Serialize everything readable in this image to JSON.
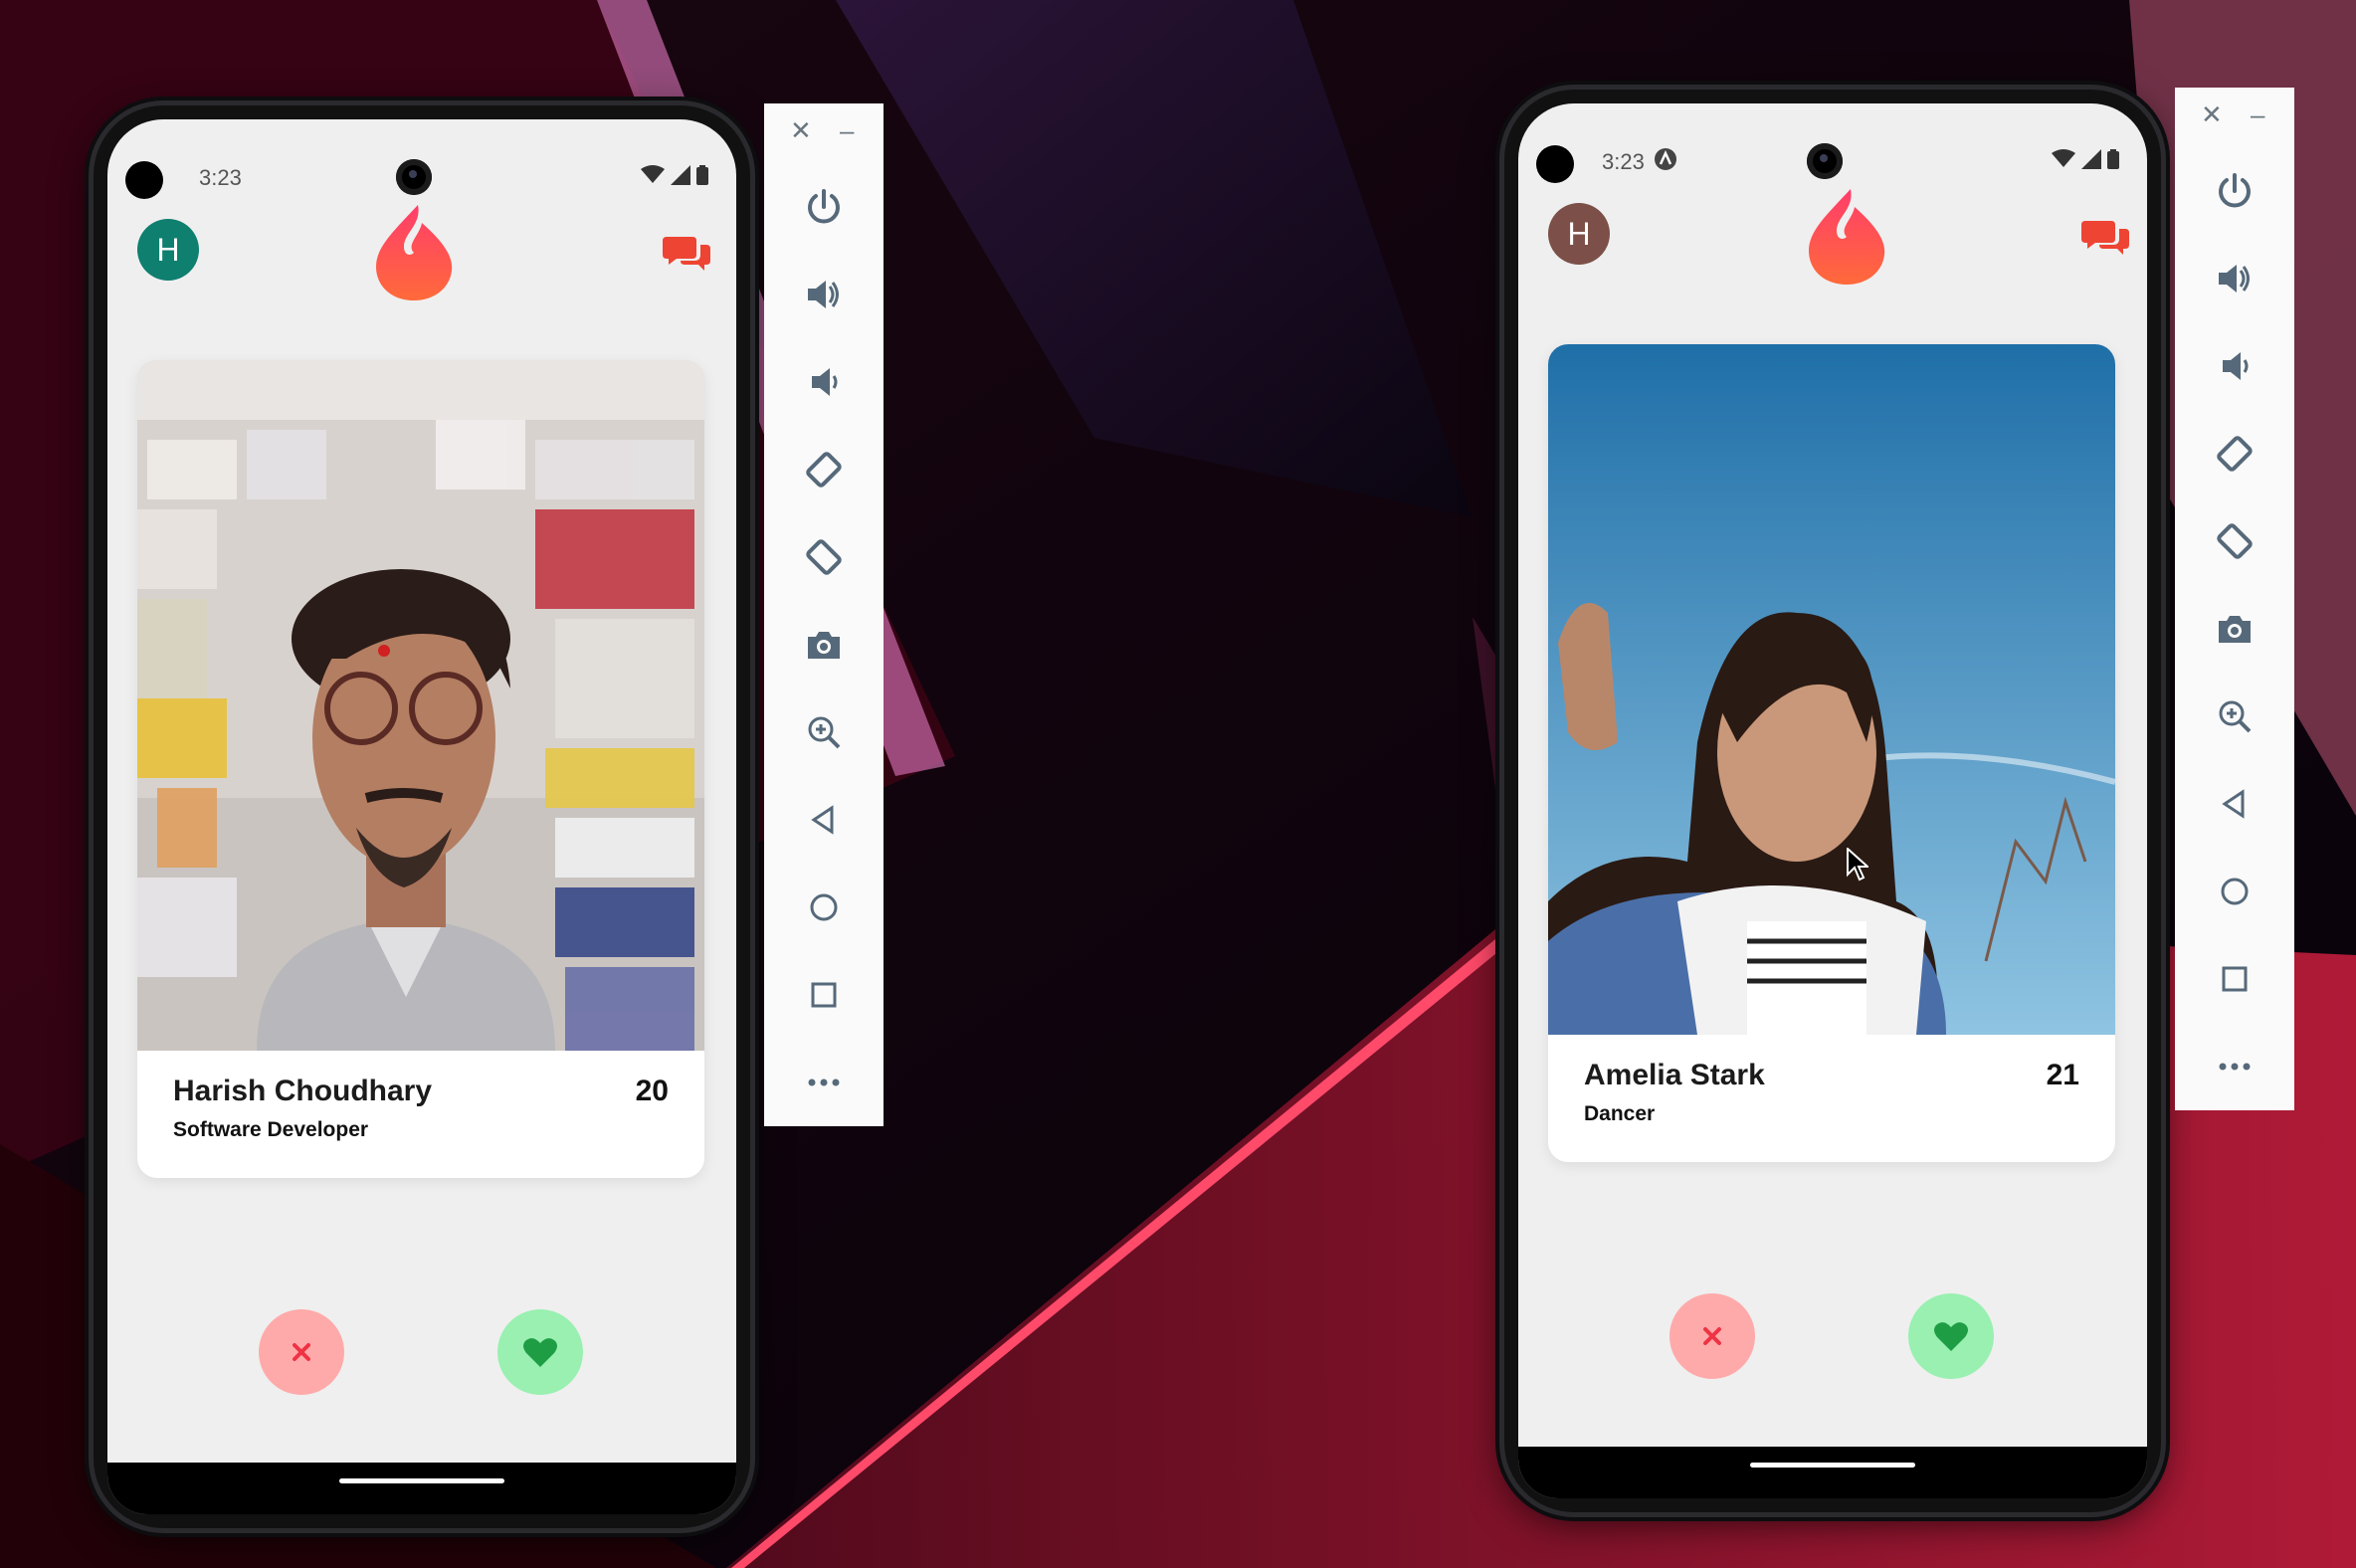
{
  "left_device": {
    "status_time": "3:23",
    "avatar_letter": "H",
    "avatar_color": "#0f7f6f",
    "profile": {
      "name": "Harish Choudhary",
      "age": "20",
      "occupation": "Software Developer"
    },
    "actions": {
      "dislike": "dislike",
      "like": "like"
    }
  },
  "right_device": {
    "status_time": "3:23",
    "avatar_letter": "H",
    "avatar_color": "#7c5048",
    "profile": {
      "name": "Amelia Stark",
      "age": "21",
      "occupation": "Dancer"
    },
    "actions": {
      "dislike": "dislike",
      "like": "like"
    }
  },
  "emulator_toolbar": {
    "buttons": [
      "power-icon",
      "volume-up-icon",
      "volume-down-icon",
      "rotate-left-icon",
      "rotate-right-icon",
      "camera-icon",
      "zoom-icon",
      "back-icon",
      "home-icon",
      "overview-icon",
      "more-icon"
    ]
  },
  "colors": {
    "flame_top": "#ff3d6b",
    "flame_bottom": "#ff6a3a",
    "chat": "#ee4433",
    "dislike_bg": "#ffaaaa",
    "dislike_icon": "#ee3344",
    "like_bg": "#99f0b0",
    "like_icon": "#1e9d45"
  }
}
